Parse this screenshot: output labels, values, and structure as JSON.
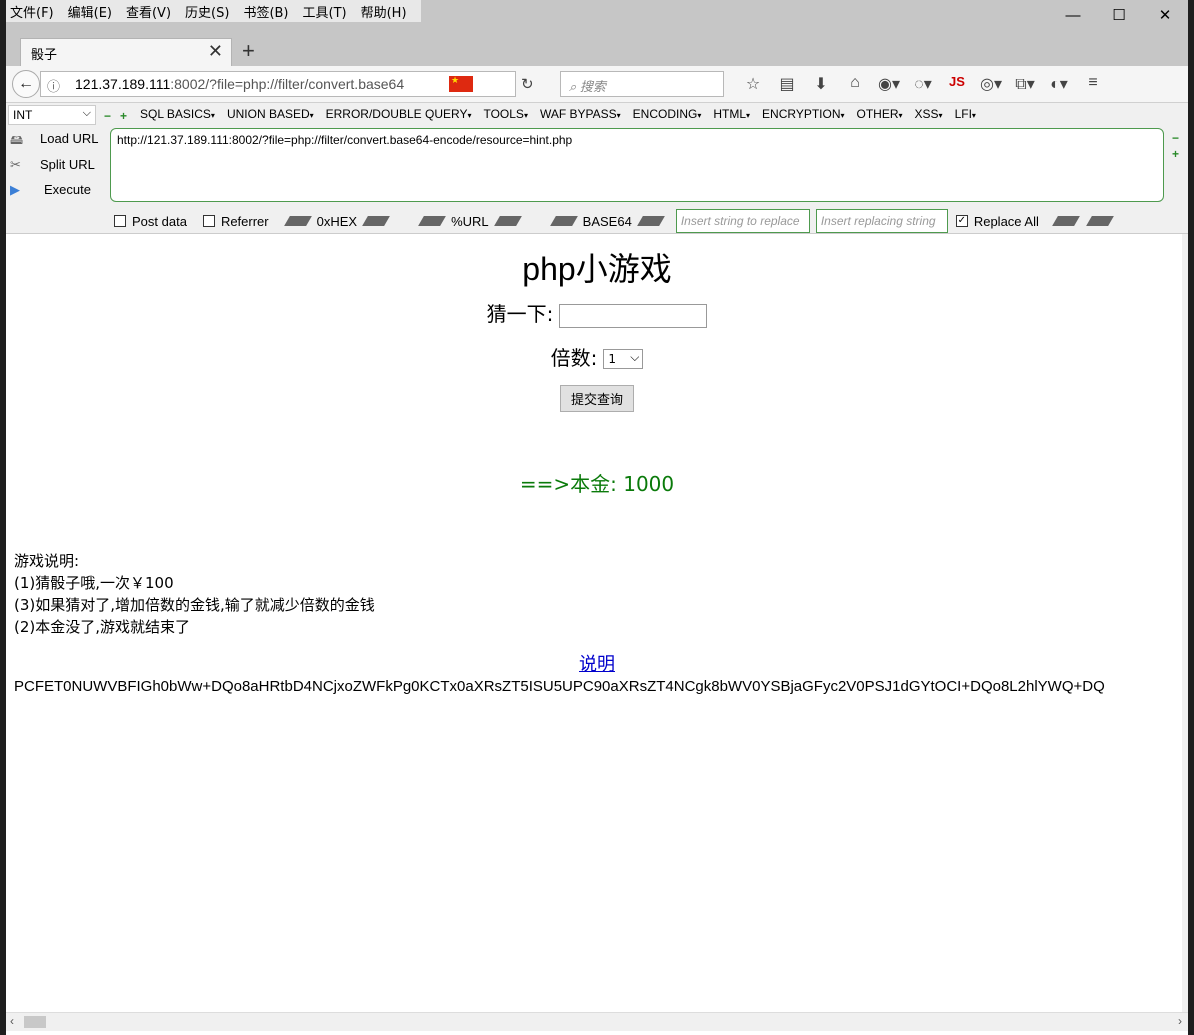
{
  "menubar": [
    "文件(F)",
    "编辑(E)",
    "查看(V)",
    "历史(S)",
    "书签(B)",
    "工具(T)",
    "帮助(H)"
  ],
  "window_controls": {
    "minimize": "—",
    "maximize": "☐",
    "close": "✕"
  },
  "tab": {
    "title": "骰子",
    "close": "✕",
    "new": "+"
  },
  "navbar": {
    "url_host": "121.37.189.111",
    "url_rest": ":8002/?file=php://filter/convert.base64",
    "search_placeholder": "搜索",
    "js_label": "JS"
  },
  "hackbar": {
    "select_value": "INT",
    "menus": [
      "SQL BASICS",
      "UNION BASED",
      "ERROR/DOUBLE QUERY",
      "TOOLS",
      "WAF BYPASS",
      "ENCODING",
      "HTML",
      "ENCRYPTION",
      "OTHER",
      "XSS",
      "LFI"
    ],
    "load_url": "Load URL",
    "split_url": "Split URL",
    "execute": "Execute",
    "url_value": "http://121.37.189.111:8002/?file=php://filter/convert.base64-encode/resource=hint.php",
    "post_data": "Post data",
    "referrer": "Referrer",
    "hex": "0xHEX",
    "urlenc": "%URL",
    "base64": "BASE64",
    "replace_placeholder": "Insert string to replace",
    "replacing_placeholder": "Insert replacing string",
    "replace_all": "Replace All",
    "replace_all_checked": true
  },
  "page": {
    "title": "php小游戏",
    "guess_label": "猜一下:",
    "multiplier_label": "倍数:",
    "multiplier_value": "1",
    "submit_label": "提交查询",
    "money": "==>本金: 1000",
    "desc_title": "游戏说明:",
    "desc_lines": [
      "(1)猜骰子哦,一次￥100",
      "(3)如果猜对了,增加倍数的金钱,输了就减少倍数的金钱",
      "(2)本金没了,游戏就结束了"
    ],
    "link": "说明",
    "base64_output": "PCFET0NUWVBFIGh0bWw+DQo8aHRtbD4NCjxoZWFkPg0KCTx0aXRsZT5ISU5UPC90aXRsZT4NCgk8bWV0YSBjaGFyc2V0PSJ1dGYtOCI+DQo8L2hlYWQ+DQ"
  },
  "colors": {
    "money": "#0a7a0a",
    "link": "#0000cc",
    "hackbar_border": "#4e9a4e"
  }
}
